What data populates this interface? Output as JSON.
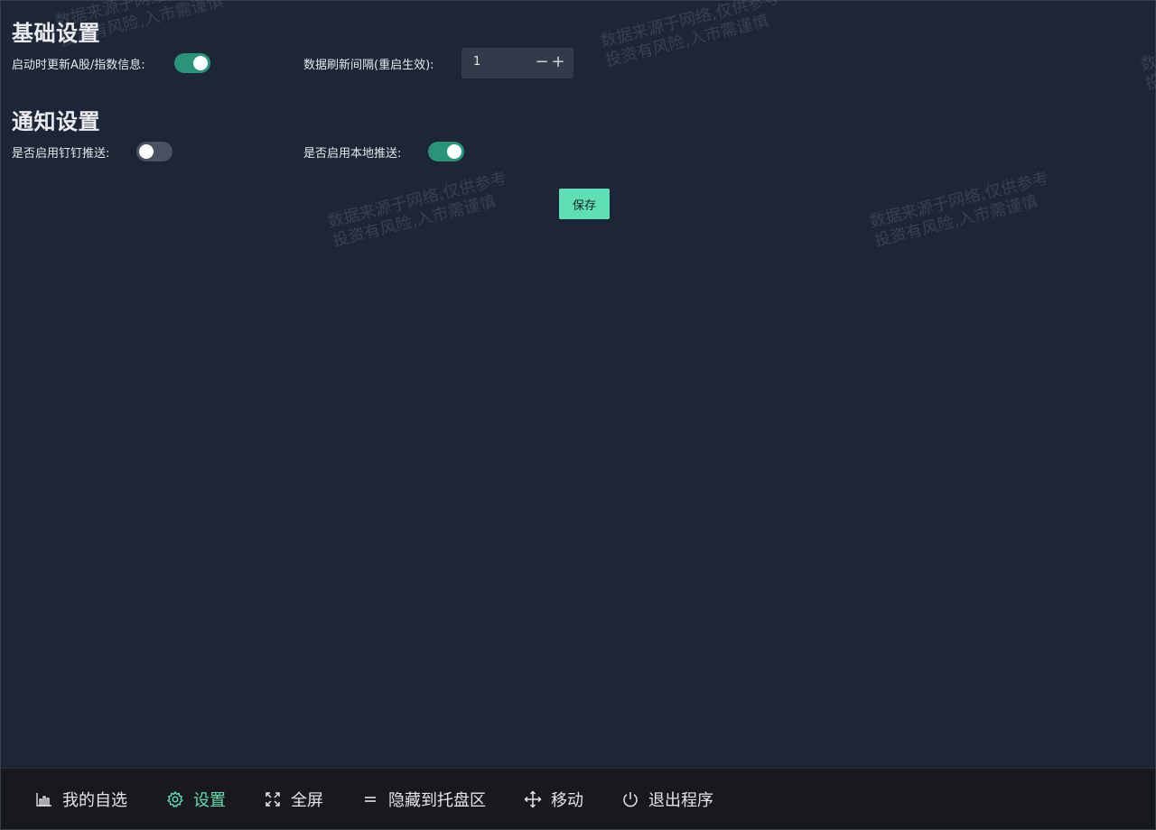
{
  "basic": {
    "title": "基础设置",
    "update_on_start_label": "启动时更新A股/指数信息:",
    "update_on_start_enabled": true,
    "refresh_interval_label": "数据刷新间隔(重启生效):",
    "refresh_interval_value": "1",
    "decrement_label": "−",
    "increment_label": "+"
  },
  "notify": {
    "title": "通知设置",
    "dingtalk_label": "是否启用钉钉推送:",
    "dingtalk_enabled": false,
    "local_label": "是否启用本地推送:",
    "local_enabled": true
  },
  "save_label": "保存",
  "watermark": {
    "line1": "数据来源于网络,仅供参考",
    "line2": "投资有风险,入市需谨慎"
  },
  "nav": {
    "items": [
      {
        "label": "我的自选",
        "icon": "bar-chart-icon",
        "active": false
      },
      {
        "label": "设置",
        "icon": "gear-icon",
        "active": true
      },
      {
        "label": "全屏",
        "icon": "fullscreen-icon",
        "active": false
      },
      {
        "label": "隐藏到托盘区",
        "icon": "equals-icon",
        "active": false
      },
      {
        "label": "移动",
        "icon": "move-icon",
        "active": false
      },
      {
        "label": "退出程序",
        "icon": "power-icon",
        "active": false
      }
    ]
  },
  "colors": {
    "background": "#1c2636",
    "accent": "#5fe0b4",
    "switch_on": "#2a9479",
    "switch_off": "#4a5262",
    "bottom_bar": "#18191d"
  }
}
